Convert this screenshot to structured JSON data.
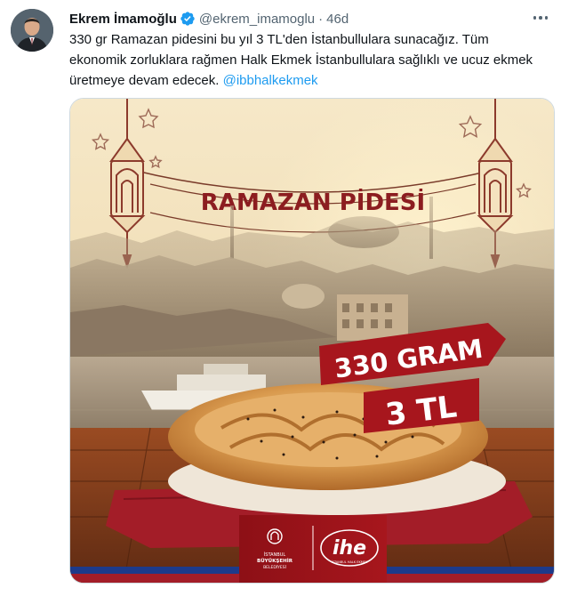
{
  "tweet": {
    "author_name": "Ekrem İmamoğlu",
    "handle": "@ekrem_imamoglu",
    "separator": "·",
    "time": "46d",
    "text": "330 gr Ramazan pidesini bu yıl 3 TL'den İstanbullulara sunacağız. Tüm ekonomik zorluklara rağmen Halk Ekmek İstanbullulara sağlıklı ve ucuz ekmek üretmeye devam edecek. ",
    "mention": "@ibbhalkekmek"
  },
  "poster": {
    "banner_text": "RAMAZAN PİDESİ",
    "weight_text": "330 GRAM",
    "price_text": "3 TL",
    "logo_ibb_line1": "İSTANBUL",
    "logo_ibb_line2": "BÜYÜKŞEHİR",
    "logo_ibb_line3": "BELEDİYESİ",
    "logo_ihe": "ihe",
    "logo_ihe_sub": "İSTANBUL HALK EKMEK"
  },
  "colors": {
    "link": "#1d9bf0",
    "verified": "#1d9bf0",
    "brand_red": "#a4161a",
    "sky": "#f3e2bd"
  },
  "icons": {
    "verified": "verified-badge-icon",
    "more": "more-options-icon"
  }
}
